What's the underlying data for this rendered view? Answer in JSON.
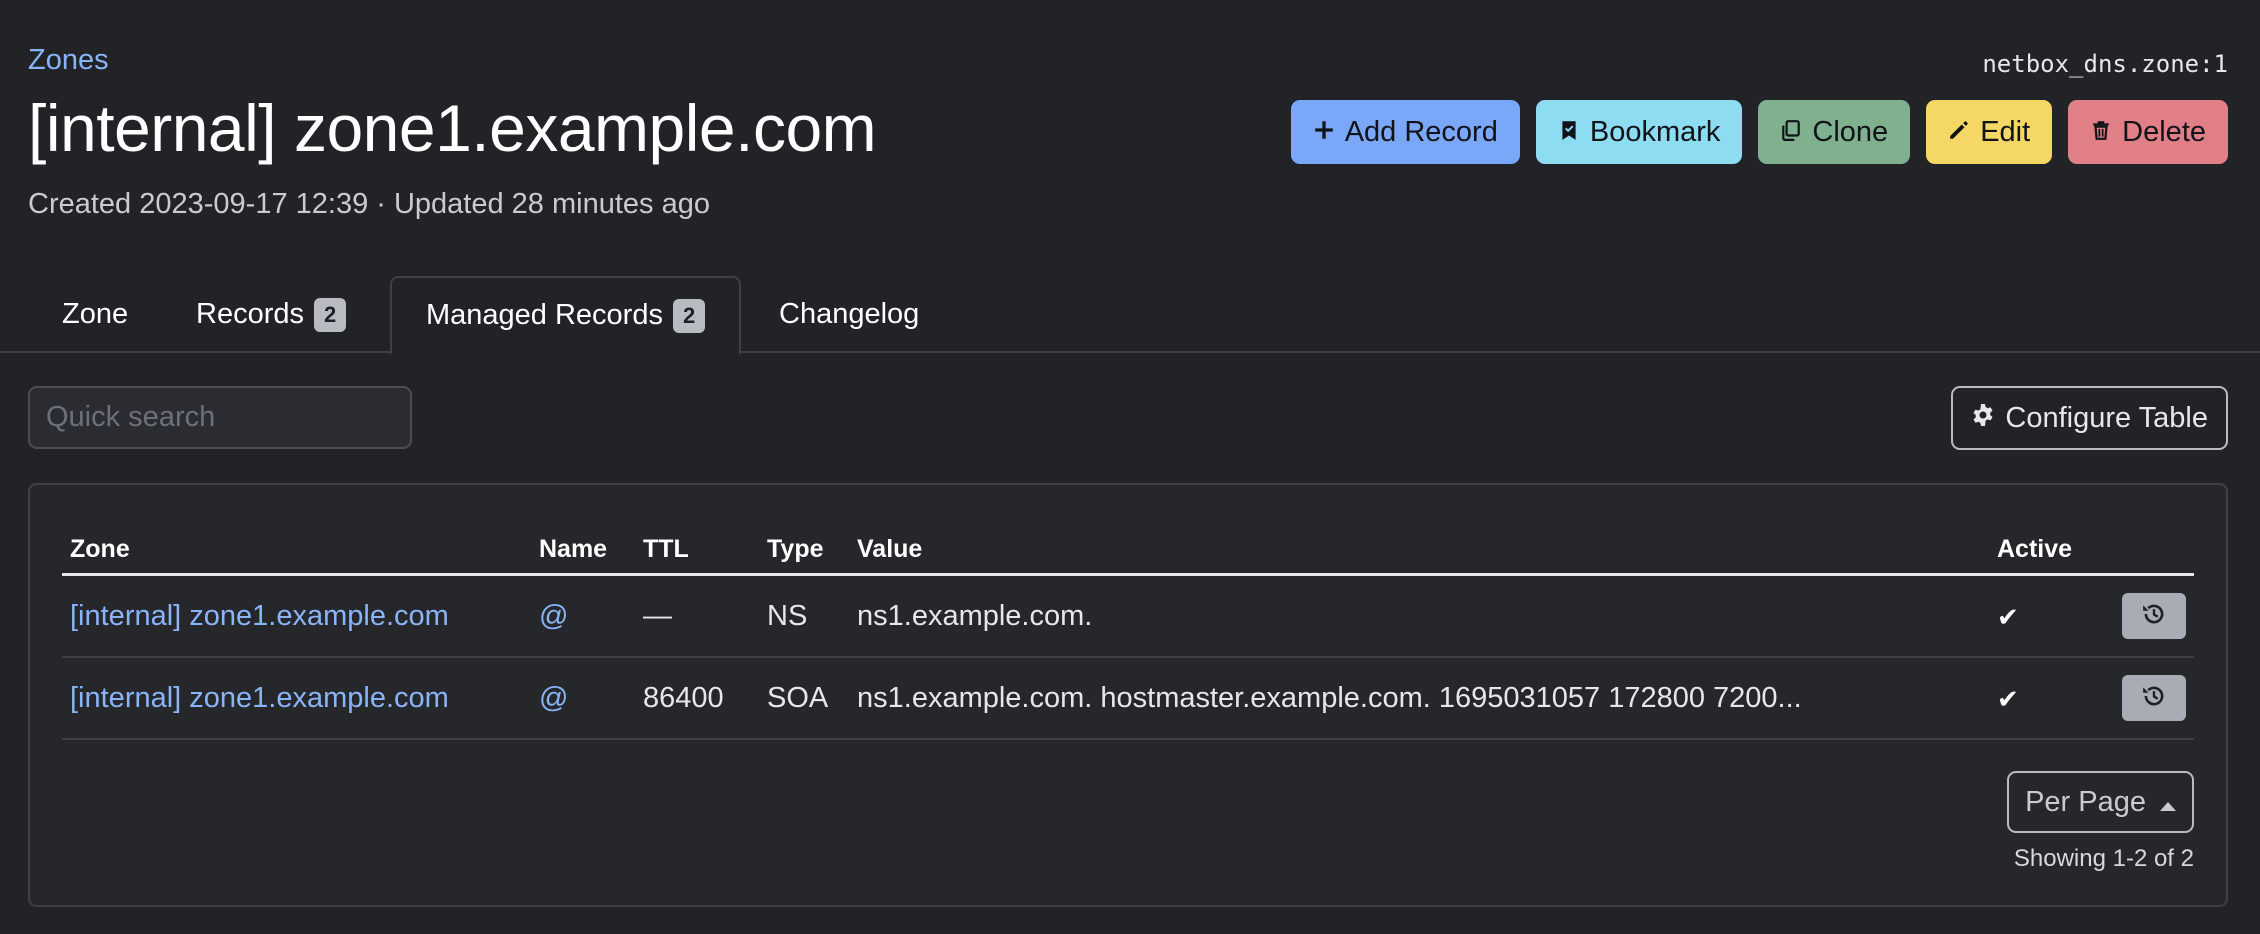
{
  "breadcrumb": {
    "label": "Zones"
  },
  "object_id": "netbox_dns.zone:1",
  "title": "[internal] zone1.example.com",
  "meta": {
    "created": "Created 2023-09-17 12:39 · Updated 28 minutes ago"
  },
  "actions": {
    "add_record": "Add Record",
    "bookmark": "Bookmark",
    "clone": "Clone",
    "edit": "Edit",
    "delete": "Delete"
  },
  "tabs": [
    {
      "label": "Zone"
    },
    {
      "label": "Records",
      "badge": "2"
    },
    {
      "label": "Managed Records",
      "badge": "2"
    },
    {
      "label": "Changelog"
    }
  ],
  "search": {
    "placeholder": "Quick search"
  },
  "configure_table": "Configure Table",
  "table": {
    "columns": [
      "Zone",
      "Name",
      "TTL",
      "Type",
      "Value",
      "Active"
    ],
    "rows": [
      {
        "zone": "[internal] zone1.example.com",
        "name": "@",
        "ttl": "—",
        "type": "NS",
        "value": "ns1.example.com.",
        "active": "✔"
      },
      {
        "zone": "[internal] zone1.example.com",
        "name": "@",
        "ttl": "86400",
        "type": "SOA",
        "value": "ns1.example.com. hostmaster.example.com. 1695031057 172800 7200...",
        "active": "✔"
      }
    ]
  },
  "pagination": {
    "per_page": "Per Page",
    "showing": "Showing 1-2 of 2"
  },
  "colors": {
    "background": "#212327",
    "link": "#8ab4f8",
    "add": "#7aa7f7",
    "bookmark": "#8ddcf2",
    "clone": "#7fb18f",
    "edit": "#f5d766",
    "delete": "#e08086"
  }
}
